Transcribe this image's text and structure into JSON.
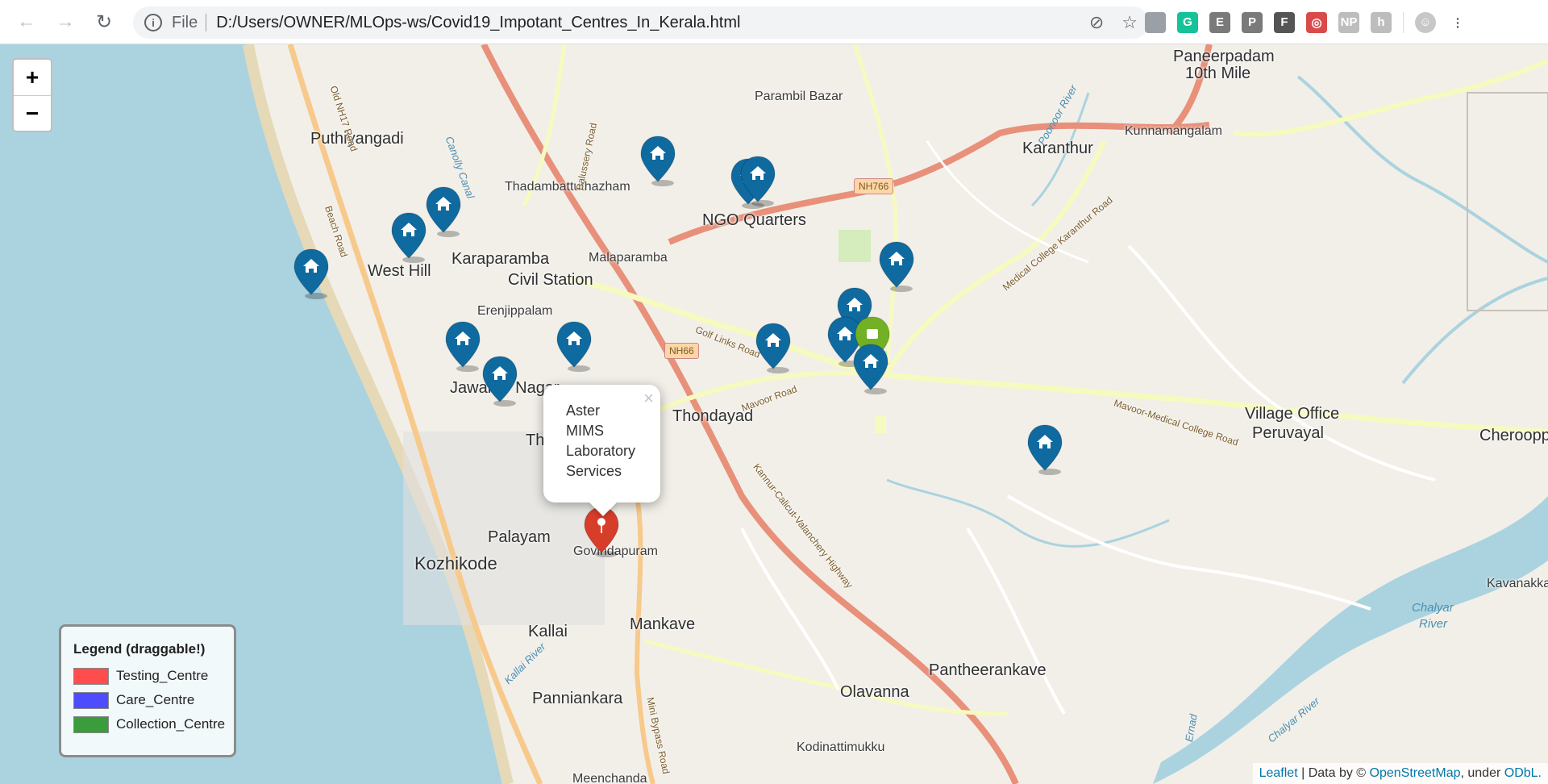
{
  "browser": {
    "scheme": "File",
    "url": "D:/Users/OWNER/MLOps-ws/Covid19_Impotant_Centres_In_Kerala.html",
    "extensions": [
      {
        "name": "reading-list-icon",
        "text": "",
        "color": "#9aa0a6"
      },
      {
        "name": "grammarly-icon",
        "text": "G",
        "color": "#15c39a"
      },
      {
        "name": "e-extension-icon",
        "text": "E",
        "color": "#7a7a7a"
      },
      {
        "name": "pinterest-icon",
        "text": "P",
        "color": "#7a7a7a"
      },
      {
        "name": "f-extension-icon",
        "text": "F",
        "color": "#555555"
      },
      {
        "name": "glasses-extension-icon",
        "text": "◎",
        "color": "#d94a4a"
      },
      {
        "name": "np-extension-icon",
        "text": "NP",
        "color": "#bdbdbd"
      },
      {
        "name": "h-extension-icon",
        "text": "h",
        "color": "#bdbdbd"
      }
    ]
  },
  "map": {
    "zoom_in": "+",
    "zoom_out": "−",
    "places": [
      "Paneerpadam",
      "10th Mile",
      "Parambil Bazar",
      "Kunnamangalam",
      "Puthiyangadi",
      "Karanthur",
      "Thadambattuthazham",
      "NGO Quarters",
      "NH766",
      "West Hill",
      "Karaparamba",
      "Malaparamba",
      "Civil Station",
      "Erenjippalam",
      "NH66",
      "Jawahar Nagar",
      "Thondayad",
      "Village Office",
      "Peruvayal",
      "Cherooppa",
      "Palayam",
      "Govindapuram",
      "Kozhikode",
      "Mankave",
      "Kallai",
      "Panniankara",
      "Olavanna",
      "Pantheerankave",
      "Kodinattimukku",
      "Kavanakkallu",
      "Chalyar",
      "River",
      "Meenchanda",
      "Th"
    ],
    "roads": [
      "Old NH17 Road",
      "Beach Road",
      "Golf Links Road",
      "Mavoor Road",
      "Medical College Karanthur Road",
      "Mavoor-Medical College Road",
      "Kannur-Calicut-Valanchery Highway",
      "Mini Bypass Road",
      "Kallai River",
      "Chalyar River",
      "Poonoor River",
      "Canolly Canal",
      "Balussery Road",
      "Ernad"
    ]
  },
  "popup": {
    "lines": [
      "Aster",
      "MIMS",
      "Laboratory",
      "Services"
    ],
    "close": "×"
  },
  "legend": {
    "title": "Legend (draggable!)",
    "items": [
      {
        "label": "Testing_Centre",
        "color": "#ff4d4d"
      },
      {
        "label": "Care_Centre",
        "color": "#4d4dff"
      },
      {
        "label": "Collection_Centre",
        "color": "#3a9c3a"
      }
    ]
  },
  "markers": {
    "care_count": 14,
    "care_color": "#0f6aa0",
    "testing_color": "#d63e2a",
    "collection_color": "#72b026"
  },
  "attribution": {
    "leaflet": "Leaflet",
    "data_by": " | Data by © ",
    "osm": "OpenStreetMap",
    "under": ", under ",
    "odbl": "ODbL."
  }
}
